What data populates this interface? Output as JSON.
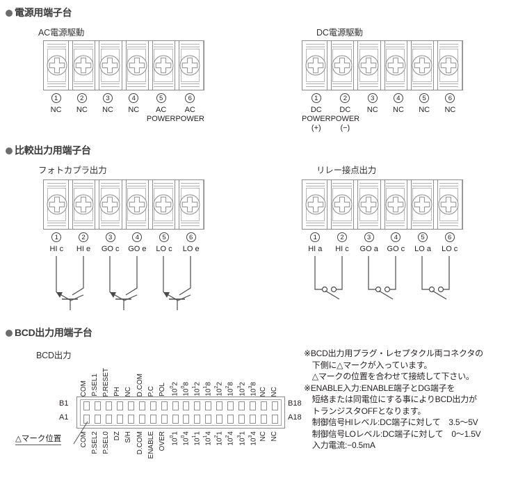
{
  "sections": {
    "power": {
      "header": "電源用端子台",
      "ac": {
        "title": "AC電源駆動",
        "numbers": [
          "1",
          "2",
          "3",
          "4",
          "5",
          "6"
        ],
        "labels": [
          "NC",
          "NC",
          "NC",
          "NC",
          "AC\nPOWER",
          "AC\nPOWER"
        ]
      },
      "dc": {
        "title": "DC電源駆動",
        "numbers": [
          "1",
          "2",
          "3",
          "4",
          "5",
          "6"
        ],
        "labels": [
          "DC\nPOWER\n(+)",
          "DC\nPOWER\n(−)",
          "NC",
          "NC",
          "NC",
          "NC"
        ]
      }
    },
    "compare": {
      "header": "比較出力用端子台",
      "photocoupler": {
        "title": "フォトカプラ出力",
        "numbers": [
          "1",
          "2",
          "3",
          "4",
          "5",
          "6"
        ],
        "labels": [
          "HI c",
          "HI e",
          "GO c",
          "GO e",
          "LO c",
          "LO e"
        ]
      },
      "relay": {
        "title": "リレー接点出力",
        "numbers": [
          "1",
          "2",
          "3",
          "4",
          "5",
          "6"
        ],
        "labels": [
          "HI a",
          "HI c",
          "GO a",
          "GO c",
          "LO a",
          "LO c"
        ]
      }
    },
    "bcd": {
      "header": "BCD出力用端子台",
      "title": "BCD出力",
      "row_b_left": "B1",
      "row_b_right": "B18",
      "row_a_left": "A1",
      "row_a_right": "A18",
      "mark_position": "△マーク位置",
      "top_labels": [
        "COM",
        "P.SEL1",
        "P.RESET",
        "PH",
        "NC",
        "D.COM",
        "P.C",
        "POL",
        "10^0 2",
        "10^0 8",
        "10^1 2",
        "10^1 8",
        "10^2 2",
        "10^2 8",
        "10^3 2",
        "10^3 8",
        "NC",
        "NC"
      ],
      "bottom_labels": [
        "COM",
        "P.SEL2",
        "P.SEL0",
        "DZ",
        "S/H",
        "D.COM",
        "ENABLE",
        "OVER",
        "10^0 1",
        "10^0 4",
        "10^1 1",
        "10^1 4",
        "10^2 1",
        "10^2 4",
        "10^3 1",
        "10^3 4",
        "NC",
        "NC"
      ],
      "notes": "※BCD出力用プラグ・レセプタクル両コネクタの\n　下側に△マークが入っています。\n　△マークの位置を合わせて接続して下さい。\n※ENABLE入力:ENABLE端子とDG端子を\n　短絡または同電位にする事によりBCD出力が\n　トランジスタOFFとなります。\n　制御信号HIレベル:DC端子に対して　3.5〜5V\n　制御信号LOレベル:DC端子に対して　0〜1.5V\n　入力電流:−0.5mA"
    }
  },
  "colors": {
    "line": "#8b8b8b",
    "text": "#231f20",
    "header": "#3a3a3a",
    "bullet": "#6d6d6d"
  }
}
